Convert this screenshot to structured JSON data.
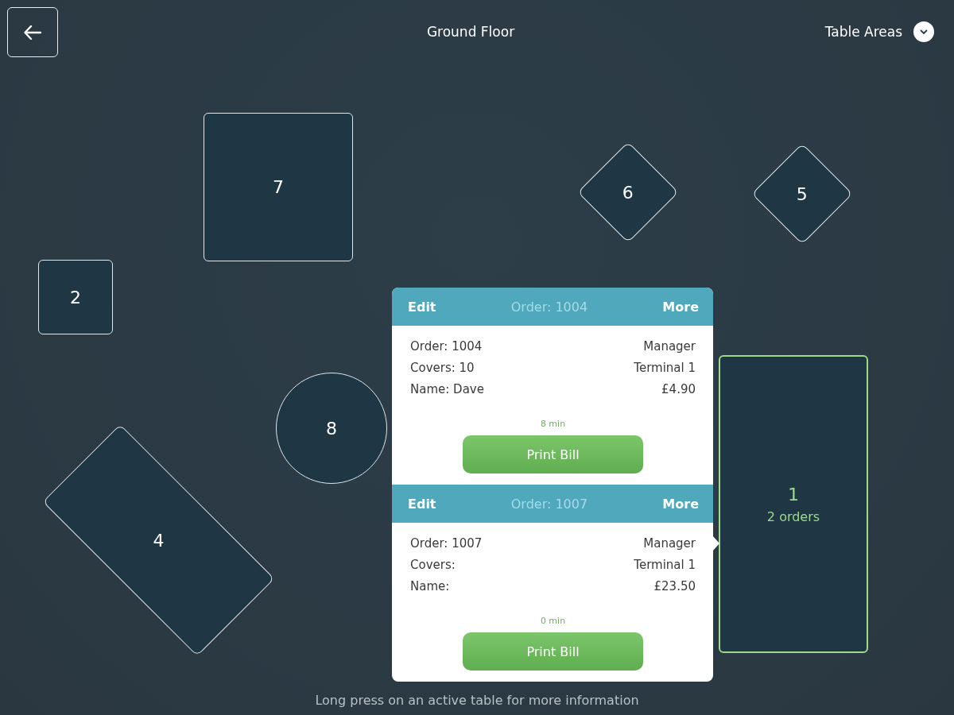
{
  "header": {
    "back_button": true,
    "title": "Ground Floor",
    "areas_menu": {
      "label": "Table Areas"
    }
  },
  "tables": [
    {
      "kind": "square",
      "number": "7",
      "selected": false
    },
    {
      "kind": "diamond",
      "number": "6",
      "selected": false
    },
    {
      "kind": "diamond",
      "number": "5",
      "selected": false
    },
    {
      "kind": "square",
      "number": "2",
      "selected": false
    },
    {
      "kind": "circle",
      "number": "8",
      "selected": false
    },
    {
      "kind": "slanted",
      "number": "4",
      "selected": false
    },
    {
      "kind": "rect",
      "number": "1",
      "selected": true,
      "orders_label": "2 orders"
    }
  ],
  "hint": "Long press on an active table for more information",
  "popover": {
    "orders": [
      {
        "edit": "Edit",
        "title": "Order: 1004",
        "more": "More",
        "left": [
          "Order: 1004",
          "Covers: 10",
          "Name: Dave"
        ],
        "right": [
          "Manager",
          "Terminal 1",
          "£4.90"
        ],
        "elapsed": "8 min",
        "button": "Print Bill"
      },
      {
        "edit": "Edit",
        "title": "Order: 1007",
        "more": "More",
        "left": [
          "Order: 1007",
          "Covers:",
          "Name:"
        ],
        "right": [
          "Manager",
          "Terminal 1",
          "£23.50"
        ],
        "elapsed": "0 min",
        "button": "Print Bill"
      }
    ]
  }
}
